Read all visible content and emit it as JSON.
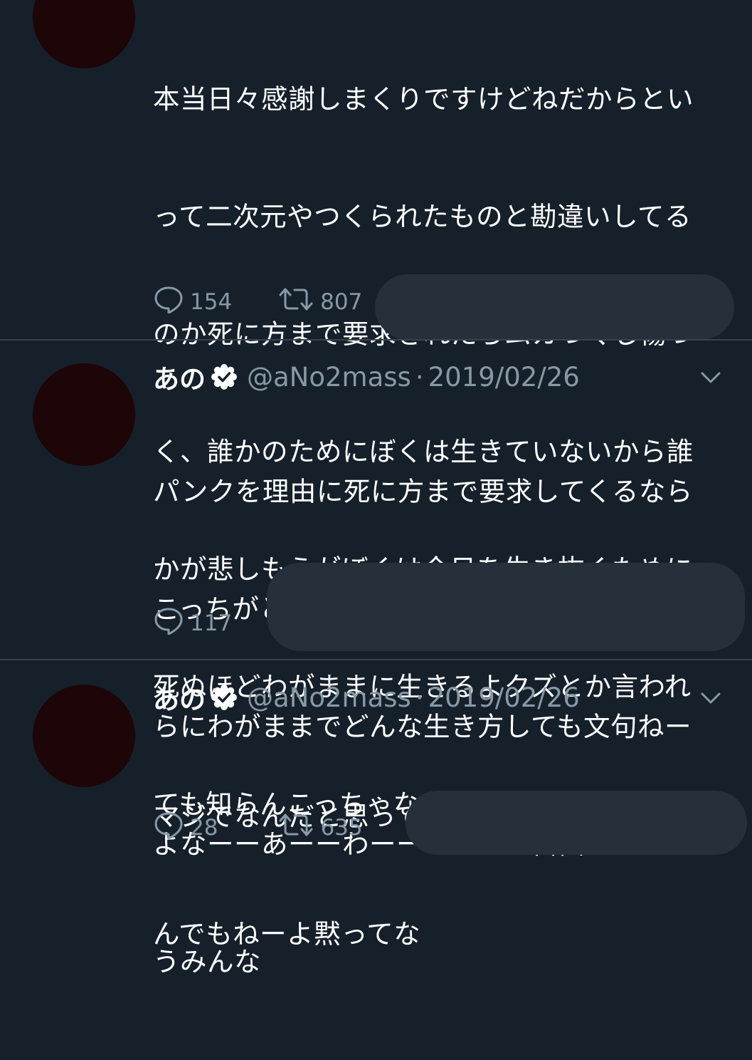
{
  "tweets": [
    {
      "lines": [
        "本当日々感謝しまくりですけどねだからとい",
        "って二次元やつくられたものと勘違いしてる",
        "のか死に方まで要求されたらムカつくし傷つ",
        "く、誰かのためにぼくは生きていないから誰",
        "かが悲しもうがぼくは今日を生き抜くために",
        "死ぬほどわがままに生きるよクズとか言われ",
        "ても知らんこっちゃないな自由でいたいんだ"
      ],
      "replies": "154",
      "retweets": "807"
    },
    {
      "name": "あの",
      "handle": "@aNo2mass",
      "separator": "·",
      "date": "2019/02/26",
      "lines": [
        "パンクを理由に死に方まで要求してくるなら",
        "こっちがとんだ最低なクズでも自由奔放に淫",
        "らにわがままでどんな生き方しても文句ねー",
        "よなーーあーーわーーー～〜〜自由に生きよ",
        "うみんな"
      ],
      "replies": "117"
    },
    {
      "name": "あの",
      "handle": "@aNo2mass",
      "separator": "·",
      "date": "2019/02/26",
      "lines": [
        "マジでなんだと思ってんだよそれは愛でもな",
        "んでもねーよ黙ってな"
      ],
      "replies": "28",
      "retweets": "635"
    }
  ],
  "colors": {
    "background": "#15202b",
    "text": "#ffffff",
    "secondary": "#8899a6",
    "divider": "#38444d",
    "verified_badge": "#ffffff",
    "redaction": "#25303a"
  },
  "icons": {
    "reply": "speech-bubble-icon",
    "retweet": "retweet-arrows-icon",
    "verified": "verified-badge-icon",
    "menu": "chevron-down-icon"
  }
}
